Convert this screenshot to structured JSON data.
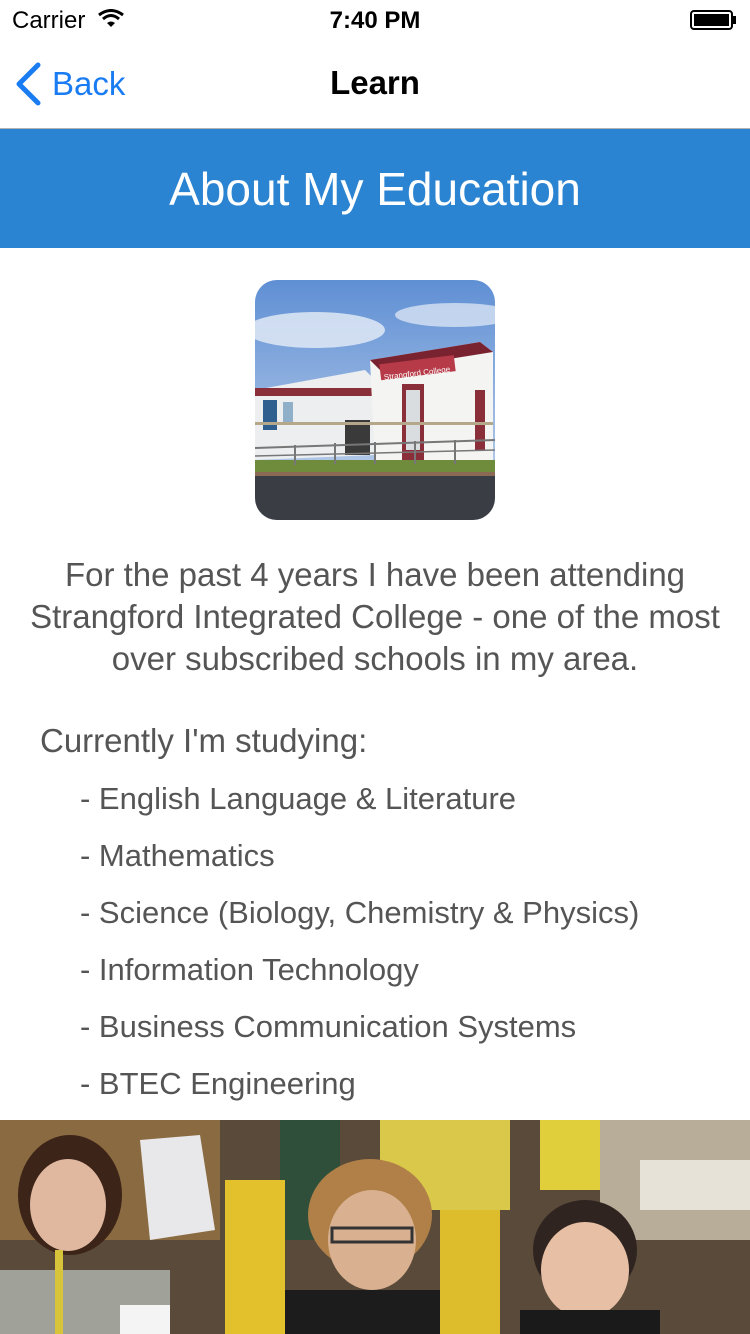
{
  "status_bar": {
    "carrier": "Carrier",
    "time": "7:40 PM",
    "icons": [
      "wifi-icon",
      "battery-icon"
    ]
  },
  "nav_bar": {
    "back_label": "Back",
    "back_icon": "chevron-left-icon",
    "title": "Learn",
    "tint_color": "#1a7cf3"
  },
  "banner": {
    "title": "About My Education",
    "background_color": "#2a84d2"
  },
  "content": {
    "intro": "For the past 4 years I have been attending Strangford Integrated College - one of the most over subscribed schools in my area.",
    "studying_heading": "Currently I'm studying:",
    "subjects": [
      "- English Language & Literature",
      "- Mathematics",
      "- Science (Biology, Chemistry & Physics)",
      "- Information Technology",
      "- Business Communication Systems",
      "- BTEC Engineering"
    ],
    "college_photo_sign": "Strangford College"
  }
}
